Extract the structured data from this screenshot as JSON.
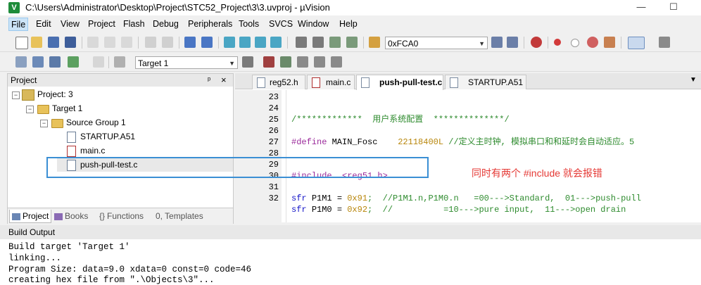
{
  "window": {
    "title": "C:\\Users\\Administrator\\Desktop\\Project\\STC52_Project\\3\\3.uvproj - µVision",
    "app_icon": "V",
    "minimize": "—",
    "maximize": "☐"
  },
  "menu": [
    "File",
    "Edit",
    "View",
    "Project",
    "Flash",
    "Debug",
    "Peripherals",
    "Tools",
    "SVCS",
    "Window",
    "Help"
  ],
  "toolbar": {
    "address_value": "0xFCA0",
    "target_value": "Target 1"
  },
  "project_panel": {
    "title": "Project",
    "pin": "ᵖ",
    "close": "×",
    "tree": {
      "root": "Project: 3",
      "target": "Target 1",
      "group": "Source Group 1",
      "files": [
        "STARTUP.A51",
        "main.c",
        "push-pull-test.c"
      ]
    },
    "tabs": [
      "Project",
      "Books",
      "Functions",
      "Templates"
    ]
  },
  "editor": {
    "tabs": [
      "reg52.h",
      "main.c",
      "push-pull-test.c",
      "STARTUP.A51"
    ],
    "active_tab": "push-pull-test.c",
    "lines": [
      {
        "n": "23",
        "segments": []
      },
      {
        "n": "24",
        "segments": [
          {
            "t": "/*************  用户系统配置  **************/",
            "c": "c-comment"
          }
        ]
      },
      {
        "n": "25",
        "segments": []
      },
      {
        "n": "26",
        "segments": [
          {
            "t": "#define ",
            "c": "c-pre"
          },
          {
            "t": "MAIN_Fosc    ",
            "c": ""
          },
          {
            "t": "22118400L",
            "c": "c-num"
          },
          {
            "t": " //定义主时钟, 模拟串口和和延时会自动适应。5",
            "c": "c-comment"
          }
        ]
      },
      {
        "n": "27",
        "segments": []
      },
      {
        "n": "28",
        "segments": []
      },
      {
        "n": "29",
        "segments": [
          {
            "t": "#include  ",
            "c": "c-pre"
          },
          {
            "t": "<reg51.h>",
            "c": "c-pre"
          }
        ]
      },
      {
        "n": "30",
        "segments": []
      },
      {
        "n": "31",
        "segments": [
          {
            "t": "sfr ",
            "c": "c-kw"
          },
          {
            "t": "P1M1 = ",
            "c": ""
          },
          {
            "t": "0x91",
            "c": "c-num"
          },
          {
            "t": ";  //P1M1.n,P1M0.n   =00--->Standard,  01--->push-pull",
            "c": "c-comment"
          }
        ]
      },
      {
        "n": "32",
        "segments": [
          {
            "t": "sfr ",
            "c": "c-kw"
          },
          {
            "t": "P1M0 = ",
            "c": ""
          },
          {
            "t": "0x92",
            "c": "c-num"
          },
          {
            "t": ";  //          =10--->pure input,  11--->open drain",
            "c": "c-comment"
          }
        ]
      }
    ]
  },
  "annotation": {
    "text": "同时有两个 #include 就会报错",
    "color": "#e53935",
    "box_color": "#3b8fd4"
  },
  "build_output": {
    "title": "Build Output",
    "lines": [
      "Build target 'Target 1'",
      "linking...",
      "Program Size: data=9.0 xdata=0 const=0 code=46",
      "creating hex file from \".\\Objects\\3\"..."
    ]
  }
}
